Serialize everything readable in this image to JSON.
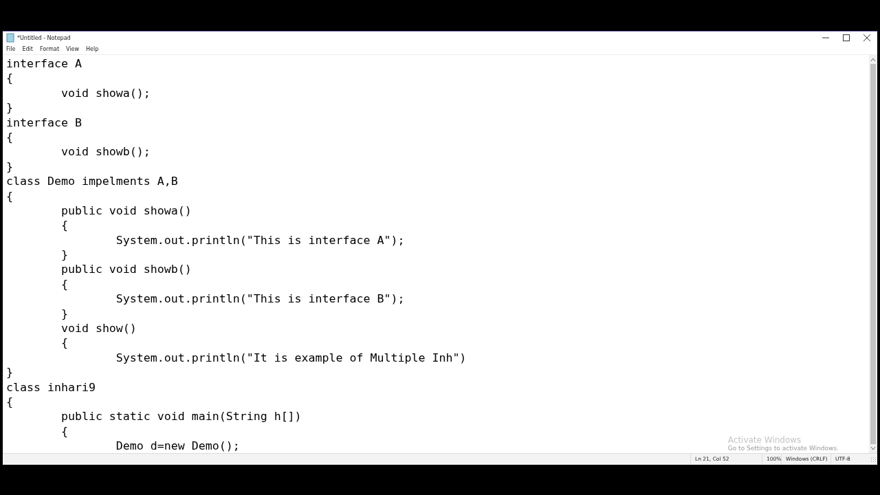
{
  "window": {
    "title": "*Untitled - Notepad"
  },
  "menu": [
    "File",
    "Edit",
    "Format",
    "View",
    "Help"
  ],
  "editor": {
    "lines": [
      "interface A",
      "{",
      "\tvoid showa();",
      "}",
      "interface B",
      "{",
      "\tvoid showb();",
      "}",
      "class Demo impelments A,B",
      "{",
      "\tpublic void showa()",
      "\t{",
      "\t\tSystem.out.println(\"This is interface A\");",
      "\t}",
      "\tpublic void showb()",
      "\t{",
      "\t\tSystem.out.println(\"This is interface B\");",
      "\t}",
      "\tvoid show()",
      "\t{",
      "\t\tSystem.out.println(\"It is example of Multiple Inh\")",
      "}",
      "class inhari9",
      "{",
      "\tpublic static void main(String h[])",
      "\t{",
      "\t\tDemo d=new Demo();"
    ]
  },
  "activation": {
    "title": "Activate Windows",
    "subtitle": "Go to Settings to activate Windows."
  },
  "status_bar": [
    "Ln 21, Col 52",
    "100%",
    "Windows (CRLF)",
    "UTF-8"
  ]
}
